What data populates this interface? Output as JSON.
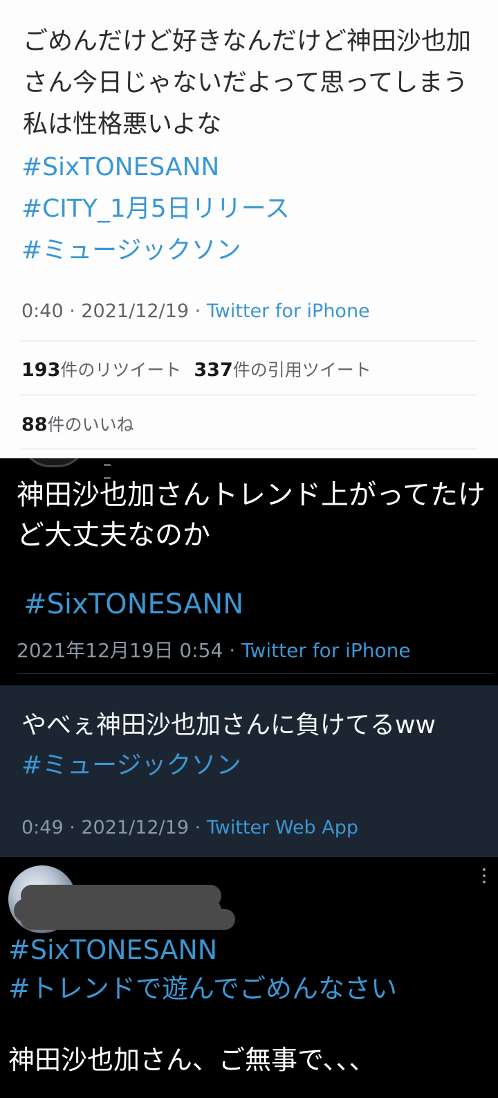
{
  "tweet1": {
    "text": "ごめんだけど好きなんだけど神田沙也加さん今日じゃないだよって思ってしまう私は性格悪いよな",
    "hashtags": [
      "#SixTONESANN",
      "#CITY_1月5日リリース",
      "#ミュージックソン"
    ],
    "time": "0:40 · 2021/12/19 · ",
    "source": "Twitter for iPhone",
    "retweets_count": "193",
    "retweets_label": "件のリツイート",
    "quotes_count": "337",
    "quotes_label": "件の引用ツイート",
    "likes_count": "88",
    "likes_label": "件のいいね"
  },
  "tweet2": {
    "text": "神田沙也加さんトレンド上がってたけど大丈夫なのか",
    "hashtag": "#SixTONESANN",
    "time": "2021年12月19日 0:54 · ",
    "source": "Twitter for iPhone"
  },
  "tweet3": {
    "text": "やべぇ神田沙也加さんに負けてるww",
    "hashtag": "#ミュージックソン",
    "time": "0:49 · 2021/12/19 · ",
    "source": "Twitter Web App"
  },
  "tweet4": {
    "hashtags": [
      "#SixTONESANN",
      "#トレンドで遊んでごめんなさい"
    ],
    "text": "神田沙也加さん、ご無事で、、、"
  }
}
